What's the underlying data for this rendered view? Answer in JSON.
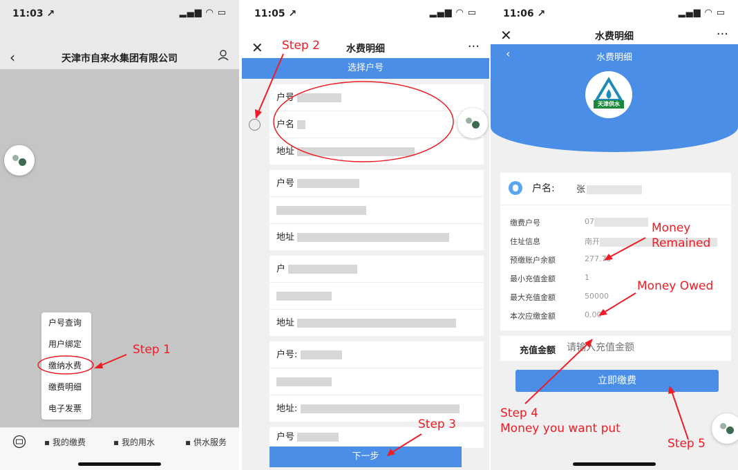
{
  "panel1": {
    "time": "11:03 ↗",
    "title": "天津市自来水集团有限公司",
    "menu": [
      "户号查询",
      "用户绑定",
      "缴纳水费",
      "缴费明细",
      "电子发票"
    ],
    "tabs": [
      "我的缴费",
      "我的用水",
      "供水服务"
    ],
    "step": "Step 1"
  },
  "panel2": {
    "time": "11:05 ↗",
    "title": "水费明细",
    "select_bar": "选择户号",
    "labels": {
      "hu_hao": "户号",
      "hu_hao_colon": "户号:",
      "hu_ming": "户名",
      "di_zhi": "地址",
      "di_zhi_colon": "地址:",
      "hu": "户"
    },
    "next": "下一步",
    "step2": "Step 2",
    "step3": "Step 3"
  },
  "panel3": {
    "time": "11:06 ↗",
    "title": "水费明细",
    "header_title": "水费明细",
    "logo_text": "天津供水",
    "account_label": "户名:",
    "account_value": "张",
    "fields": [
      {
        "label": "缴费户号",
        "value": "07"
      },
      {
        "label": "住址信息",
        "value": "南开"
      },
      {
        "label": "预缴账户余额",
        "value": "277.70"
      },
      {
        "label": "最小充值金额",
        "value": "1"
      },
      {
        "label": "最大充值金额",
        "value": "50000"
      },
      {
        "label": "本次应缴金额",
        "value": "0.00"
      }
    ],
    "recharge_label": "充值金额",
    "recharge_placeholder": "请输入充值金额",
    "pay_button": "立即缴费",
    "ann_money": "Money",
    "ann_remained": "Remained",
    "ann_owed": "Money Owed",
    "step4": "Step 4",
    "step4_sub": "Money you want put",
    "step5": "Step 5"
  },
  "colors": {
    "accent": "#4a8ee8",
    "annotation": "#ee1c24"
  }
}
